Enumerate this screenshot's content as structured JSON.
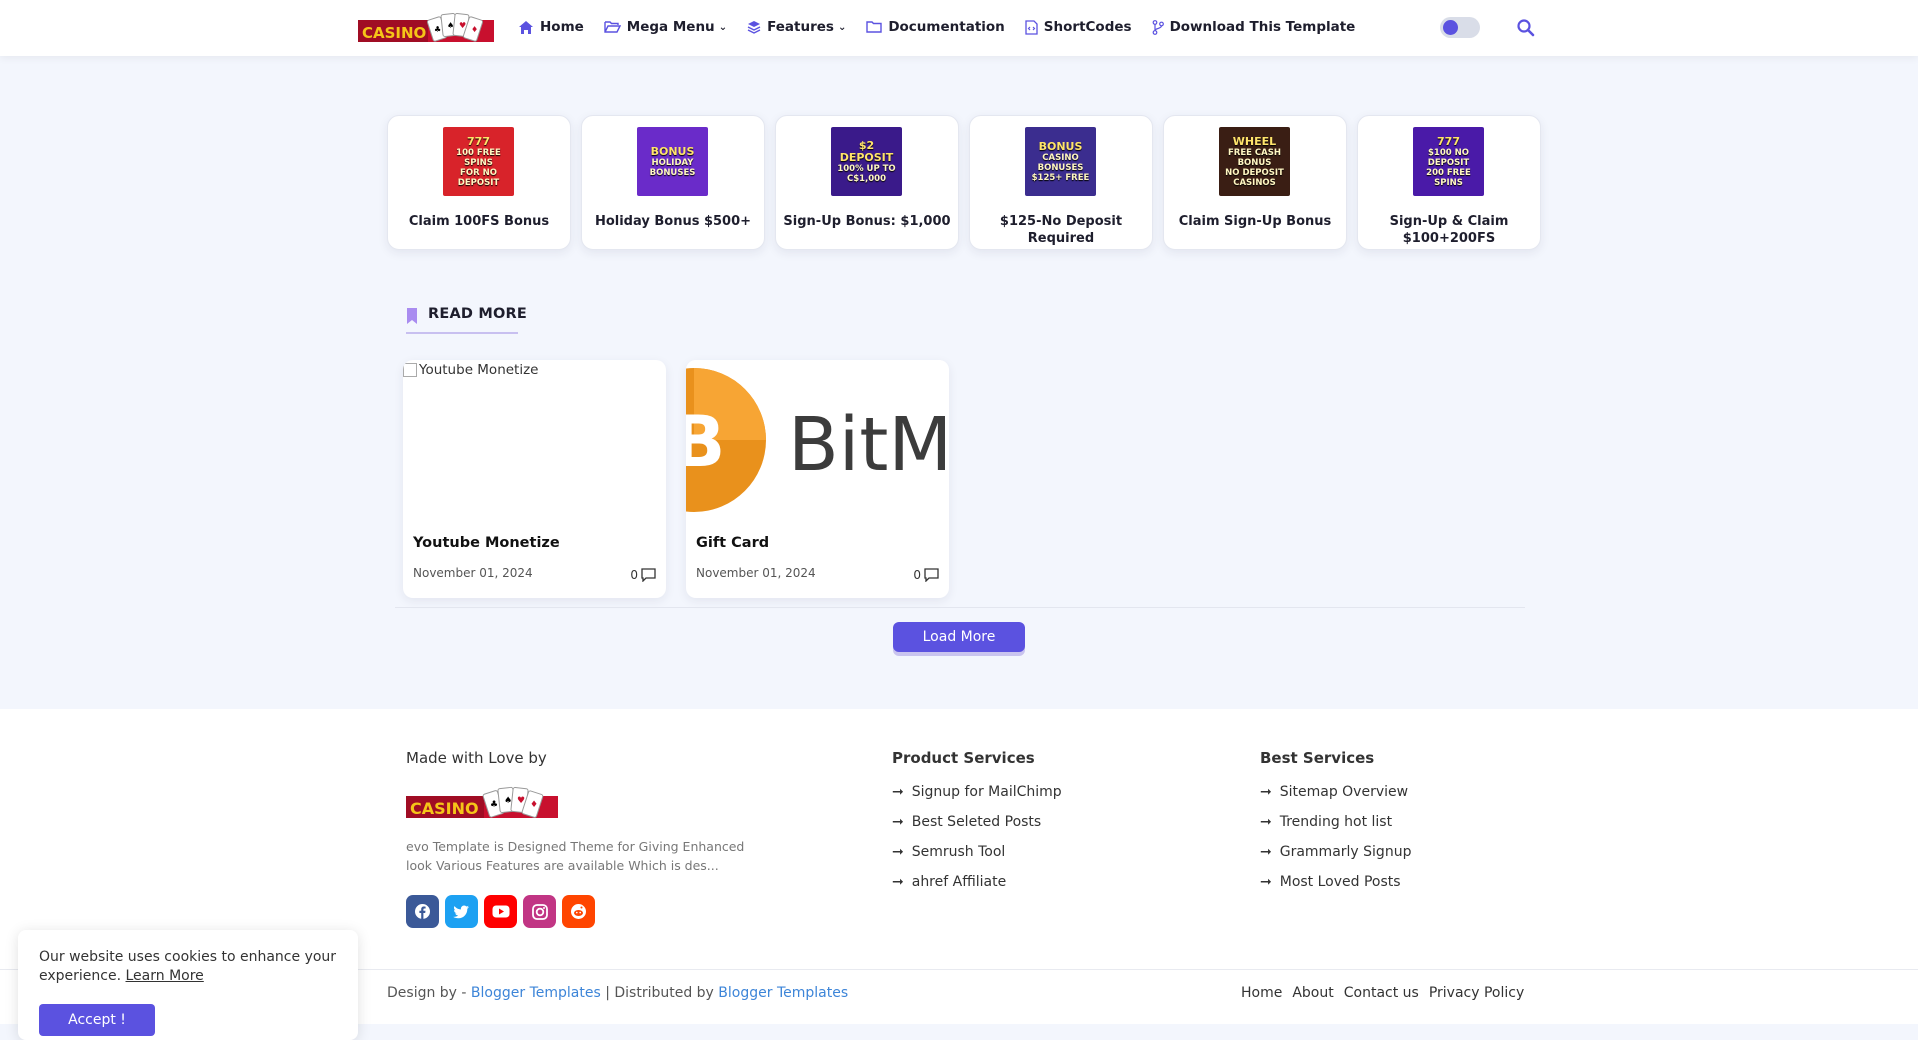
{
  "header": {
    "logo_text": "CASINO",
    "nav": [
      {
        "label": "Home",
        "icon": "home-icon"
      },
      {
        "label": "Mega Menu",
        "icon": "folder-open-icon",
        "dropdown": true
      },
      {
        "label": "Features",
        "icon": "layers-icon",
        "dropdown": true
      },
      {
        "label": "Documentation",
        "icon": "folder-icon"
      },
      {
        "label": "ShortCodes",
        "icon": "code-file-icon"
      },
      {
        "label": "Download This Template",
        "icon": "git-branch-icon"
      }
    ],
    "dark_mode_toggle": "off",
    "search_icon": "search-icon"
  },
  "bonuses": [
    {
      "title": "Claim 100FS Bonus",
      "img_line1": "777",
      "img_line2": "100 FREE SPINS",
      "img_line3": "FOR NO DEPOSIT",
      "bg": "#d8232a"
    },
    {
      "title": "Holiday Bonus $500+",
      "img_line1": "BONUS",
      "img_line2": "HOLIDAY",
      "img_line3": "BONUSES",
      "bg": "#6a2bc9"
    },
    {
      "title": "Sign-Up Bonus: $1,000",
      "img_line1": "$2 DEPOSIT",
      "img_line2": "100% UP TO",
      "img_line3": "C$1,000",
      "bg": "#3a1a8a"
    },
    {
      "title": "$125-No Deposit Required",
      "img_line1": "BONUS",
      "img_line2": "CASINO BONUSES",
      "img_line3": "$125+ FREE",
      "bg": "#3b2d8f"
    },
    {
      "title": "Claim Sign-Up Bonus",
      "img_line1": "WHEEL",
      "img_line2": "FREE CASH BONUS",
      "img_line3": "NO DEPOSIT CASINOS",
      "bg": "#3a1e14"
    },
    {
      "title": "Sign-Up & Claim $100+200FS",
      "img_line1": "777",
      "img_line2": "$100 NO DEPOSIT",
      "img_line3": "200 FREE SPINS",
      "bg": "#4a1aa8"
    }
  ],
  "read_more": {
    "heading": "READ MORE",
    "posts": [
      {
        "title": "Youtube Monetize",
        "date": "November 01, 2024",
        "comments": "0",
        "thumb_alt": "Youtube Monetize"
      },
      {
        "title": "Gift Card",
        "date": "November 01, 2024",
        "comments": "0",
        "thumb_text": "BitM"
      }
    ],
    "load_more": "Load More"
  },
  "footer": {
    "made_with": "Made with Love by",
    "logo_text": "CASINO",
    "description": "evo Template is Designed Theme for Giving Enhanced look Various Features are available Which is des...",
    "socials": [
      {
        "icon": "facebook-icon",
        "color": "#3b5998"
      },
      {
        "icon": "twitter-icon",
        "color": "#1da1f2"
      },
      {
        "icon": "youtube-icon",
        "color": "#ff0000"
      },
      {
        "icon": "instagram-icon",
        "color": "#c13584"
      },
      {
        "icon": "reddit-icon",
        "color": "#ff4500"
      }
    ],
    "product_services": {
      "heading": "Product Services",
      "links": [
        "Signup for MailChimp",
        "Best Seleted Posts",
        "Semrush Tool",
        "ahref Affiliate"
      ]
    },
    "best_services": {
      "heading": "Best Services",
      "links": [
        "Sitemap Overview",
        "Trending hot list",
        "Grammarly Signup",
        "Most Loved Posts"
      ]
    },
    "credit_prefix": "Design by - ",
    "credit_link1": "Blogger Templates",
    "credit_mid": " | Distributed by ",
    "credit_link2": "Blogger Templates",
    "bottom_links": [
      "Home",
      "About",
      "Contact us",
      "Privacy Policy"
    ]
  },
  "cookie": {
    "text": "Our website uses cookies to enhance your experience.",
    "learn_more": "Learn More",
    "accept": "Accept !"
  },
  "colors": {
    "accent": "#5b52e0",
    "link": "#3d85d8",
    "background": "#f3f6fd"
  }
}
